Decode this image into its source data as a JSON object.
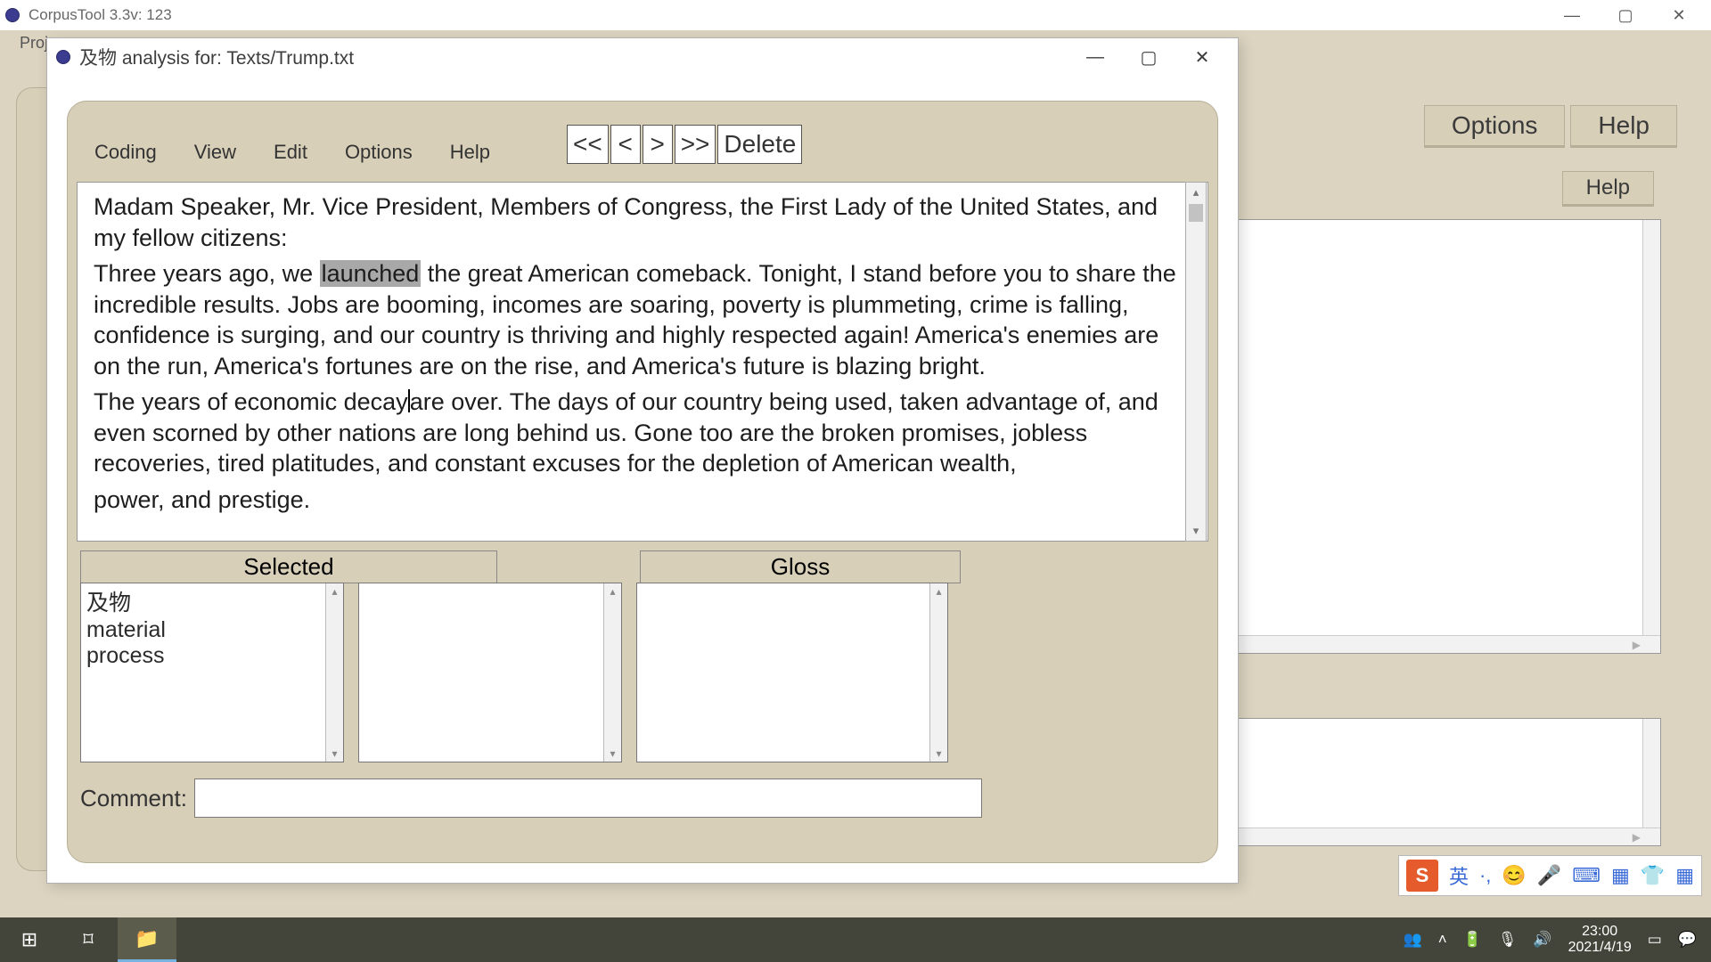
{
  "outer": {
    "title": "CorpusTool 3.3v: 123",
    "proj_label": "Proje",
    "win": {
      "min": "—",
      "max": "▢",
      "close": "✕"
    }
  },
  "right_toolbar": {
    "options": "Options",
    "help": "Help",
    "help2": "Help"
  },
  "inner": {
    "title": "及物 analysis for: Texts/Trump.txt",
    "win": {
      "min": "—",
      "max": "▢",
      "close": "✕"
    },
    "menu": {
      "coding": "Coding",
      "view": "View",
      "edit": "Edit",
      "options": "Options",
      "help": "Help"
    },
    "nav": {
      "first": "<<",
      "prev": "<",
      "next": ">",
      "last": ">>",
      "delete": "Delete"
    },
    "text": {
      "p1": "Madam Speaker, Mr. Vice President, Members of Congress, the First Lady of the United States, and my fellow citizens:",
      "p2_pre": "Three years ago, we ",
      "p2_hl": "launched",
      "p2_post": " the great American comeback. Tonight, I stand before you to share the incredible results. Jobs are booming, incomes are soaring, poverty is plummeting, crime is falling, confidence is surging, and our country is thriving and highly respected again! America's enemies are on the run, America's fortunes are on the rise, and America's future is blazing bright.",
      "p3a": "The years of economic decay",
      "p3b": "are over. The days of our country being used, taken advantage of, and even scorned by other nations are long behind us. Gone too are the broken promises, jobless recoveries, tired platitudes, and constant excuses for the depletion of American wealth,",
      "p3c": "power, and prestige."
    },
    "headers": {
      "selected": "Selected",
      "gloss": "Gloss"
    },
    "selected_items": {
      "i1": "及物",
      "i2": "material",
      "i3": "process"
    },
    "comment_label": "Comment:",
    "comment_value": ""
  },
  "ime": {
    "lang": "英",
    "dot": "·,",
    "face": "😊",
    "mic": "🎤",
    "key": "⌨",
    "grid": "▦",
    "skin": "👕",
    "more": "▦"
  },
  "taskbar": {
    "start": "⊞",
    "task_view": "⌑",
    "explorer": "📁",
    "people": "👥",
    "tray": {
      "chev": "˄",
      "bat": "🔋",
      "mic": "🎙",
      "vol": "🔊"
    },
    "time": "23:00",
    "date": "2021/4/19",
    "notif": "▭",
    "chat": "💬"
  }
}
